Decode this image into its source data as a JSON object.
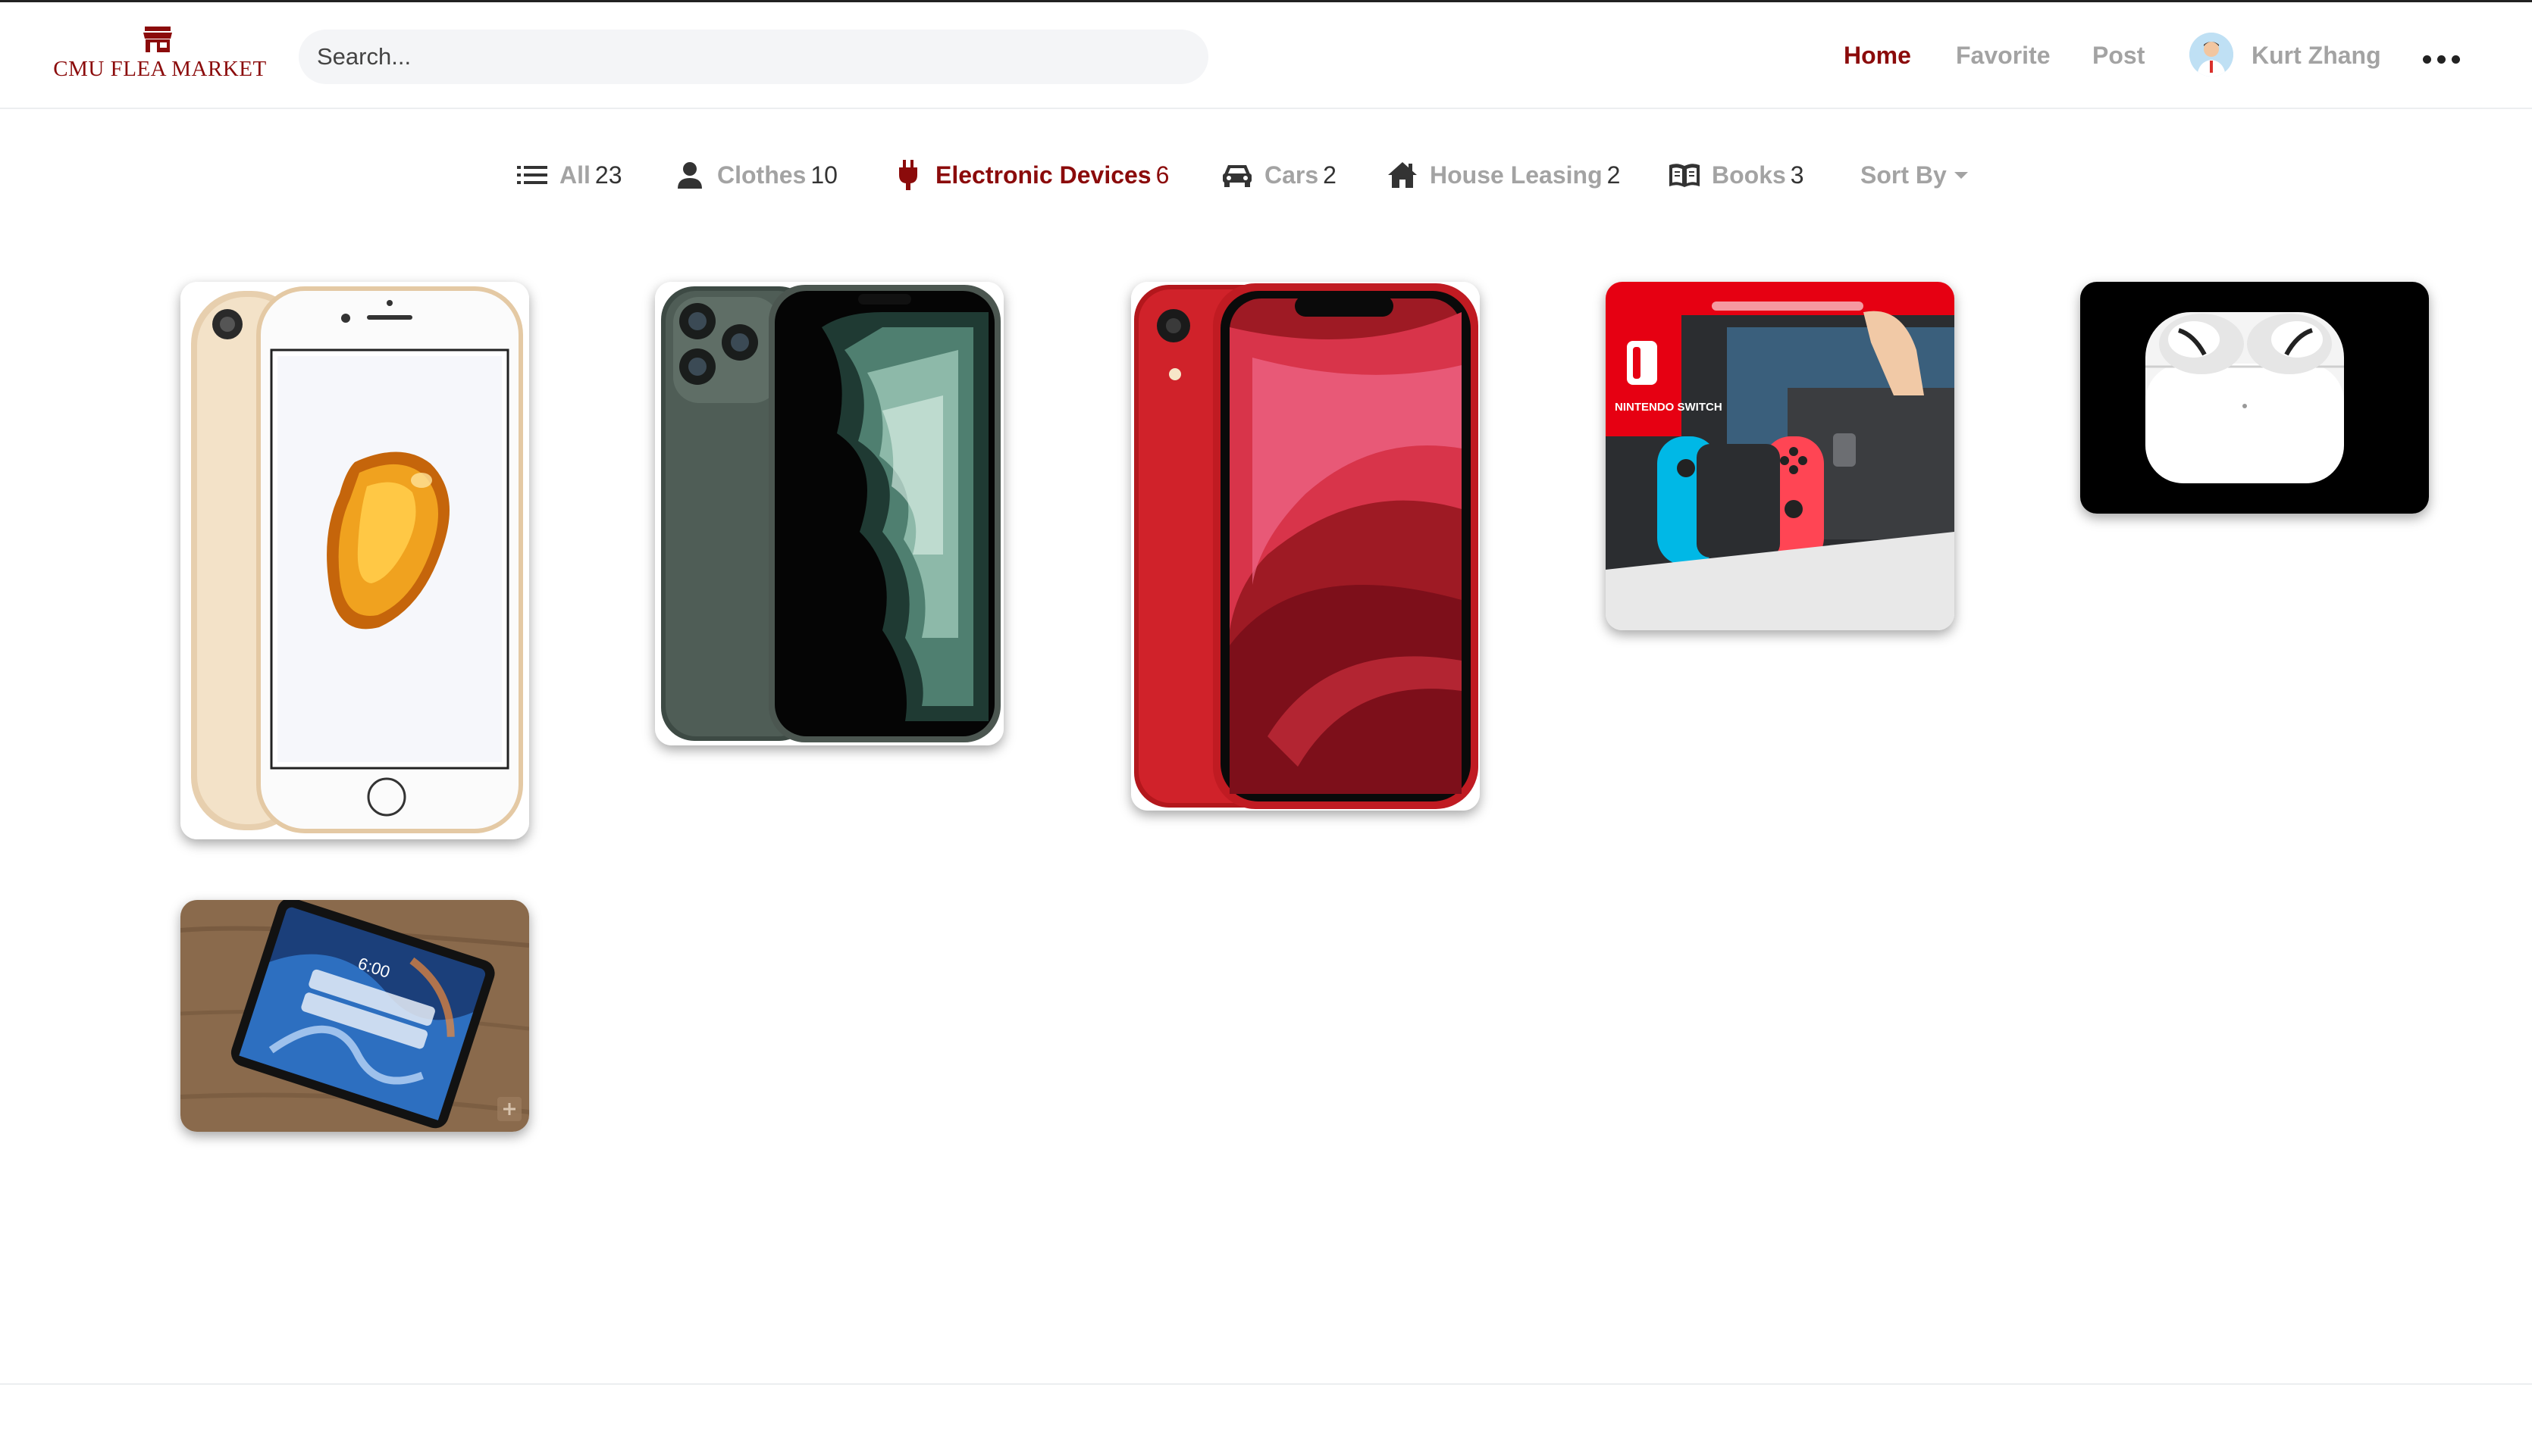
{
  "header": {
    "logo_text": "CMU FLEA MARKET",
    "search_placeholder": "Search...",
    "nav": {
      "home": "Home",
      "favorite": "Favorite",
      "post": "Post"
    },
    "user_name": "Kurt Zhang",
    "accent_color": "#8b0b0b"
  },
  "categories": [
    {
      "label": "All",
      "count": "23",
      "icon": "list-icon",
      "active": false
    },
    {
      "label": "Clothes",
      "count": "10",
      "icon": "person-icon",
      "active": false
    },
    {
      "label": "Electronic Devices",
      "count": "6",
      "icon": "plug-icon",
      "active": true
    },
    {
      "label": "Cars",
      "count": "2",
      "icon": "car-icon",
      "active": false
    },
    {
      "label": "House Leasing",
      "count": "2",
      "icon": "house-icon",
      "active": false
    },
    {
      "label": "Books",
      "count": "3",
      "icon": "book-icon",
      "active": false
    }
  ],
  "sort_label": "Sort By",
  "products": [
    {
      "image": "iphone-7-gold"
    },
    {
      "image": "iphone-11-pro-midnight-green"
    },
    {
      "image": "iphone-xr-red"
    },
    {
      "image": "nintendo-switch"
    },
    {
      "image": "airpods-pro"
    },
    {
      "image": "ipad-pro"
    }
  ],
  "product_image_text": {
    "switch_logo": "NINTENDO SWITCH",
    "ipad_time": "6:00"
  }
}
